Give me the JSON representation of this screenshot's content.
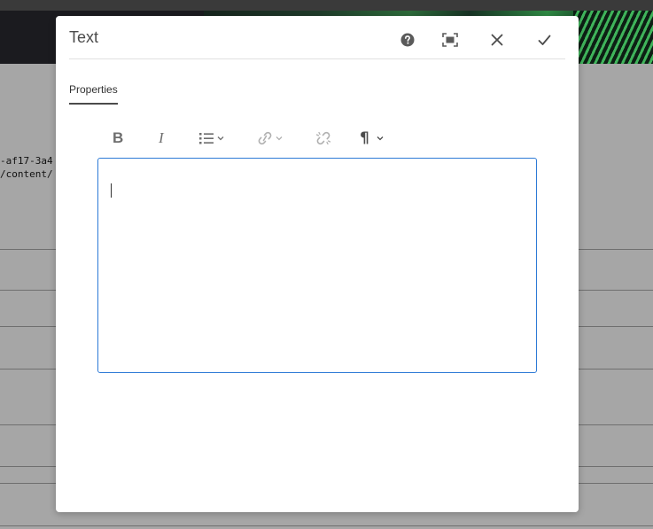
{
  "background": {
    "code_lines": [
      "-af17-3a4",
      "/content/"
    ]
  },
  "dialog": {
    "title": "Text",
    "header_buttons": [
      {
        "name": "help-button",
        "icon": "help-circle-icon"
      },
      {
        "name": "fullscreen-button",
        "icon": "fullscreen-icon"
      },
      {
        "name": "cancel-button",
        "icon": "close-icon"
      },
      {
        "name": "done-button",
        "icon": "checkmark-icon"
      }
    ],
    "tabs": [
      {
        "label": "Properties",
        "selected": true
      }
    ],
    "rte_toolbar": {
      "bold_label": "B",
      "italic_label": "I",
      "paragraph_label": "¶"
    },
    "editor": {
      "content": ""
    }
  }
}
